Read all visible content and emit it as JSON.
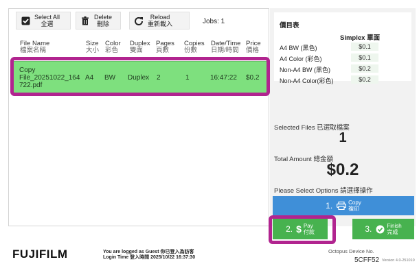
{
  "toolbar": {
    "select_all": {
      "en": "Select All",
      "zh": "全選"
    },
    "delete": {
      "en": "Delete",
      "zh": "刪除"
    },
    "reload": {
      "en": "Reload",
      "zh": "重新載入"
    },
    "jobs_text": "Jobs: 1"
  },
  "table": {
    "headers": [
      {
        "en": "File Name",
        "zh": "檔案名稱"
      },
      {
        "en": "Size",
        "zh": "大小"
      },
      {
        "en": "Color",
        "zh": "彩色"
      },
      {
        "en": "Duplex",
        "zh": "雙面"
      },
      {
        "en": "Pages",
        "zh": "頁數"
      },
      {
        "en": "Copies",
        "zh": "份數"
      },
      {
        "en": "Date/Time",
        "zh": "日期/時間"
      },
      {
        "en": "Price",
        "zh": "價格"
      }
    ],
    "rows": [
      {
        "file_name": [
          "Copy",
          "File_20251022_164",
          "722.pdf"
        ],
        "size": "A4",
        "color": "BW",
        "duplex": "Duplex",
        "pages": "2",
        "copies": "1",
        "time": "16:47:22",
        "price": "$0.2"
      }
    ]
  },
  "price_table": {
    "title": "價目表",
    "column_header": "Simplex 單面",
    "rows": [
      {
        "name": "A4 BW (黑色)",
        "price": "$0.1"
      },
      {
        "name": "A4 Color (彩色)",
        "price": "$0.1"
      },
      {
        "name": "Non-A4 BW (黑色)",
        "price": "$0.2"
      },
      {
        "name": "Non-A4 Color(彩色)",
        "price": "$0.2"
      }
    ]
  },
  "summary": {
    "selected_label": "Selected Files 已選取檔案",
    "selected_value": "1",
    "total_label": "Total Amount 總金額",
    "total_value": "$0.2",
    "options_label": "Please Select Options 請選擇操作"
  },
  "actions": {
    "copy": {
      "num": "1.",
      "en": "Copy",
      "zh": "複印"
    },
    "pay": {
      "num": "2.",
      "en": "Pay",
      "zh": "付款"
    },
    "finish": {
      "num": "3.",
      "en": "Finish",
      "zh": "完成"
    }
  },
  "footer": {
    "logo": "FUJIFILM",
    "login_line1": "You are logged as Guest 你已登入為訪客",
    "login_line2": "Login Time 登入時間 2025/10/22 16:37:30",
    "device_label": "Octopus Device No.",
    "device_value": "5CFF52",
    "version": "Version 4.0-251010"
  },
  "colors": {
    "selected_row": "#7ee07e",
    "highlight": "#b1248f",
    "copy_button": "#3f8fd8",
    "action_button": "#47b24f"
  }
}
